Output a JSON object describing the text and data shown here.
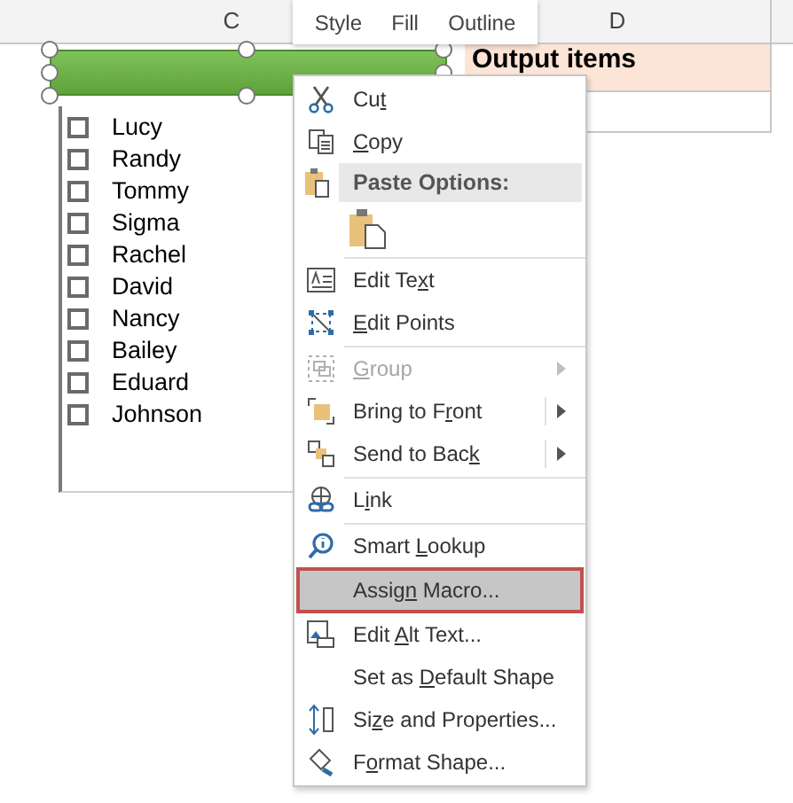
{
  "mini_toolbar": {
    "tabs": [
      {
        "label": "Style",
        "selected": false
      },
      {
        "label": "Fill",
        "selected": false
      },
      {
        "label": "Outline",
        "selected": false
      }
    ]
  },
  "sheet": {
    "columns": [
      "C",
      "D"
    ],
    "output_header": "Output items"
  },
  "list_box": {
    "items": [
      {
        "label": "Lucy",
        "checked": false
      },
      {
        "label": "Randy",
        "checked": false
      },
      {
        "label": "Tommy",
        "checked": false
      },
      {
        "label": "Sigma",
        "checked": false
      },
      {
        "label": "Rachel",
        "checked": false
      },
      {
        "label": "David",
        "checked": false
      },
      {
        "label": "Nancy",
        "checked": false
      },
      {
        "label": "Bailey",
        "checked": false
      },
      {
        "label": "Eduard",
        "checked": false
      },
      {
        "label": "Johnson",
        "checked": false
      }
    ]
  },
  "context_menu": {
    "items": [
      {
        "kind": "item",
        "label": {
          "pre": "Cu",
          "key": "t"
        },
        "disabled": false,
        "selected": false,
        "submenu": false
      },
      {
        "kind": "item",
        "label": {
          "key": "C",
          "post": "opy"
        },
        "disabled": false,
        "selected": false,
        "submenu": false
      },
      {
        "kind": "header",
        "label": "Paste Options:"
      },
      {
        "kind": "paste"
      },
      {
        "kind": "separator"
      },
      {
        "kind": "item",
        "label": {
          "pre": "Edit Te",
          "key": "x",
          "post": "t"
        },
        "disabled": false,
        "selected": false,
        "submenu": false
      },
      {
        "kind": "item",
        "label": {
          "key": "E",
          "post": "dit Points"
        },
        "disabled": false,
        "selected": false,
        "submenu": false
      },
      {
        "kind": "separator"
      },
      {
        "kind": "item",
        "label": {
          "key": "G",
          "post": "roup"
        },
        "disabled": true,
        "selected": false,
        "submenu": true
      },
      {
        "kind": "item",
        "label": {
          "pre": "Bring to F",
          "key": "r",
          "post": "ont"
        },
        "disabled": false,
        "selected": false,
        "submenu": true
      },
      {
        "kind": "item",
        "label": {
          "pre": "Send to Bac",
          "key": "k"
        },
        "disabled": false,
        "selected": false,
        "submenu": true
      },
      {
        "kind": "separator"
      },
      {
        "kind": "item",
        "label": {
          "pre": "L",
          "key": "i",
          "post": "nk"
        },
        "disabled": false,
        "selected": false,
        "submenu": false
      },
      {
        "kind": "separator"
      },
      {
        "kind": "item",
        "label": {
          "pre": "Smart ",
          "key": "L",
          "post": "ookup"
        },
        "disabled": false,
        "selected": false,
        "submenu": false
      },
      {
        "kind": "item",
        "label": {
          "pre": "Assig",
          "key": "n",
          "post": " Macro..."
        },
        "disabled": false,
        "selected": true,
        "submenu": false
      },
      {
        "kind": "item",
        "label": {
          "pre": "Edit ",
          "key": "A",
          "post": "lt Text..."
        },
        "disabled": false,
        "selected": false,
        "submenu": false
      },
      {
        "kind": "item",
        "label": {
          "pre": "Set as ",
          "key": "D",
          "post": "efault Shape"
        },
        "disabled": false,
        "selected": false,
        "submenu": false
      },
      {
        "kind": "item",
        "label": {
          "pre": "Si",
          "key": "z",
          "post": "e and Properties..."
        },
        "disabled": false,
        "selected": false,
        "submenu": false
      },
      {
        "kind": "item",
        "label": {
          "pre": "F",
          "key": "o",
          "post": "rmat Shape..."
        },
        "disabled": false,
        "selected": false,
        "submenu": false
      }
    ]
  }
}
